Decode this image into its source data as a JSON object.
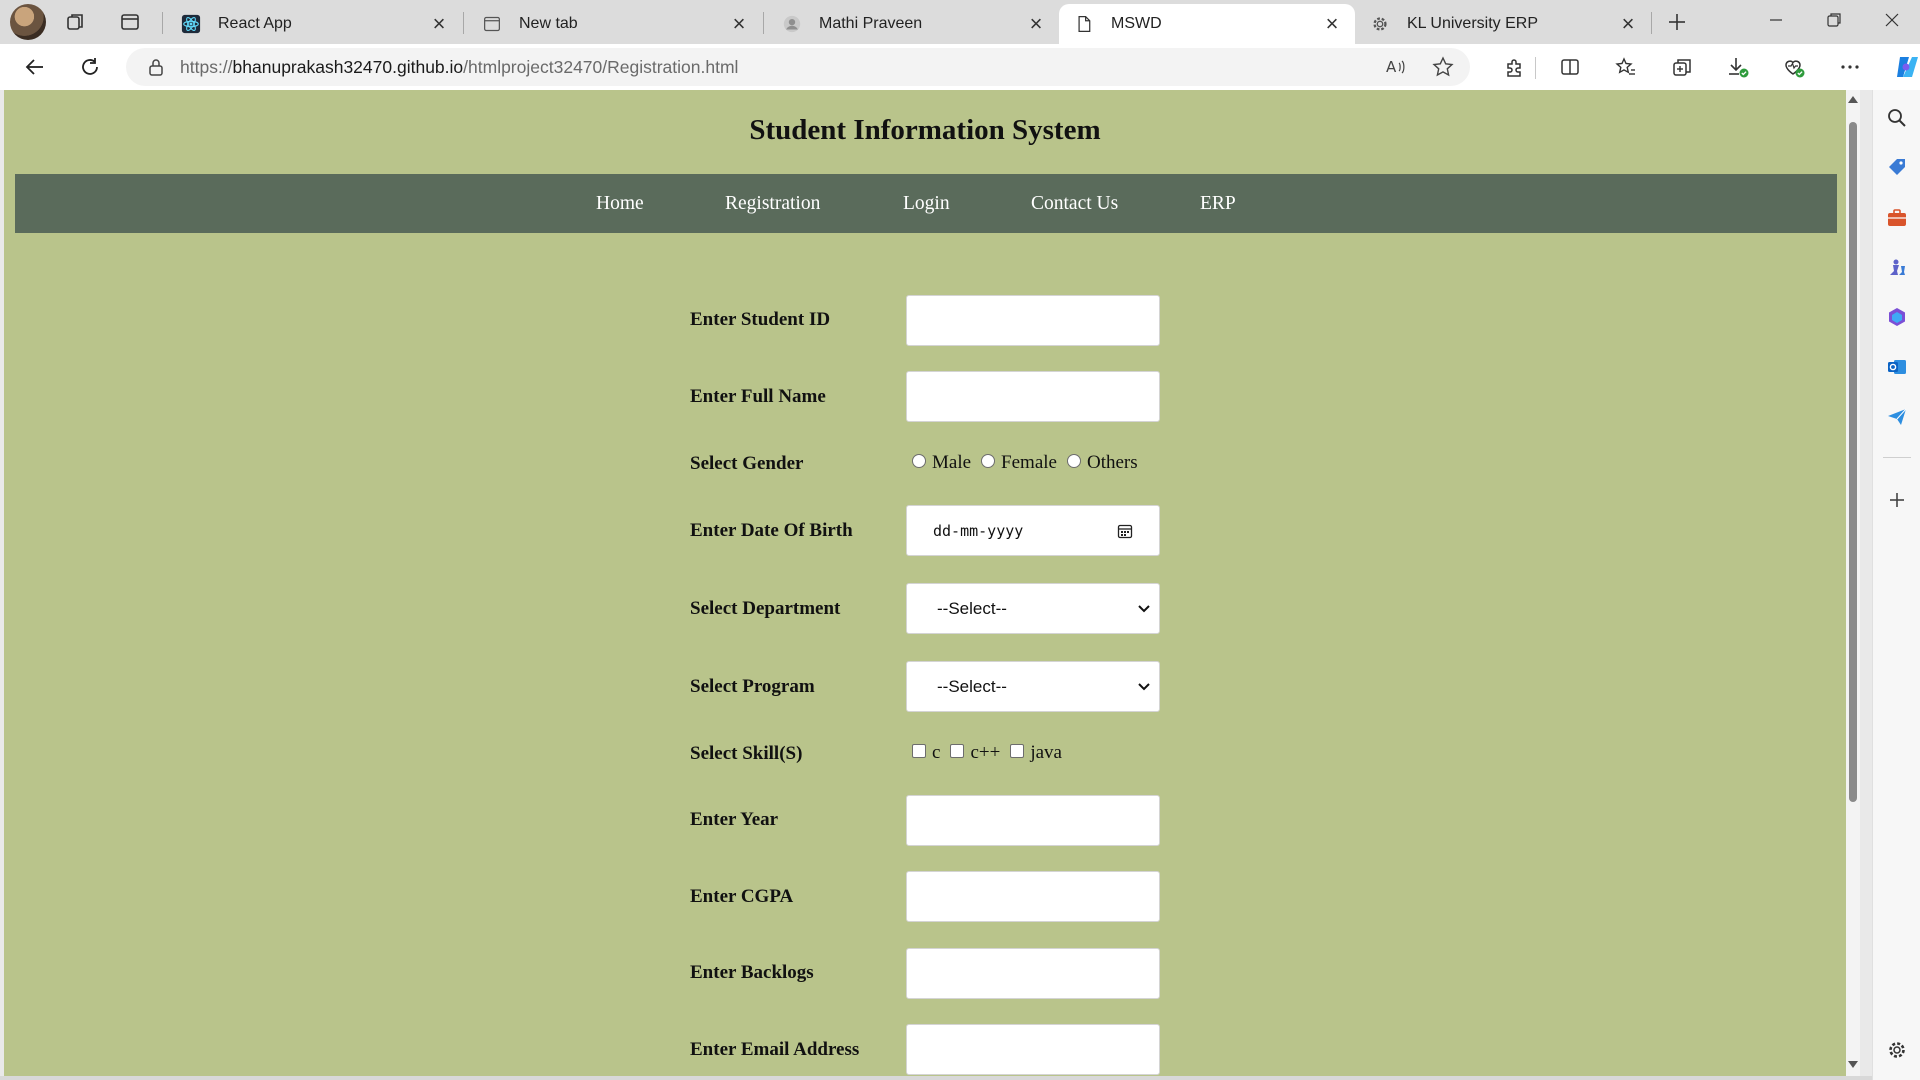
{
  "browser": {
    "tabs": [
      {
        "title": "React App",
        "icon": "react-icon"
      },
      {
        "title": "New tab",
        "icon": "new-tab-icon"
      },
      {
        "title": "Mathi Praveen",
        "icon": "profile-photo-icon"
      },
      {
        "title": "MSWD",
        "icon": "page-icon",
        "active": true
      },
      {
        "title": "KL University ERP",
        "icon": "gear-icon"
      }
    ],
    "url_prefix": "https://",
    "url_host": "bhanuprakash32470.github.io",
    "url_path": "/htmlproject32470/Registration.html"
  },
  "page": {
    "title": "Student Information System",
    "nav": [
      "Home",
      "Registration",
      "Login",
      "Contact Us",
      "ERP"
    ],
    "form": {
      "student_id_label": "Enter Student ID",
      "full_name_label": "Enter Full Name",
      "gender_label": "Select Gender",
      "gender_options": [
        "Male",
        "Female",
        "Others"
      ],
      "dob_label": "Enter Date Of Birth",
      "dob_placeholder": "dd-mm-yyyy",
      "department_label": "Select Department",
      "department_value": "--Select--",
      "program_label": "Select Program",
      "program_value": "--Select--",
      "skills_label": "Select Skill(S)",
      "skill_options": [
        "c",
        "c++",
        "java"
      ],
      "year_label": "Enter Year",
      "cgpa_label": "Enter CGPA",
      "backlogs_label": "Enter Backlogs",
      "email_label": "Enter Email Address"
    }
  },
  "colors": {
    "page_background": "#b9c48b",
    "navbar_background": "#5a6b5b",
    "navbar_text": "#ffffff"
  }
}
